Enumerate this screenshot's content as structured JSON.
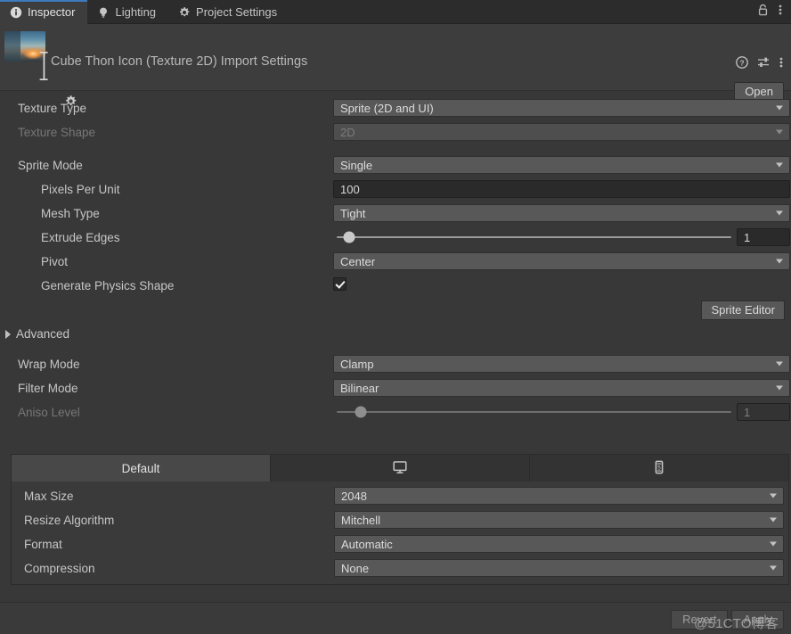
{
  "window": {
    "tabs": [
      {
        "label": "Inspector",
        "icon": "info-icon",
        "active": true
      },
      {
        "label": "Lighting",
        "icon": "lightbulb-icon",
        "active": false
      },
      {
        "label": "Project Settings",
        "icon": "gear-icon",
        "active": false
      }
    ],
    "lock_icon": "lock-icon",
    "menu_icon": "kebab-menu-icon"
  },
  "object_header": {
    "title": "Cube Thon Icon (Texture 2D) Import Settings",
    "thumbnail_alt": "texture-preview-thumbnail",
    "help_icon": "help-icon",
    "preset_icon": "preset-icon",
    "menu_icon": "kebab-menu-icon",
    "open_label": "Open",
    "gear_icon": "gear-icon"
  },
  "properties": [
    {
      "label": "Texture Type",
      "value": "Sprite (2D and UI)",
      "control": "dropdown",
      "disabled": false,
      "indent": 0
    },
    {
      "label": "Texture Shape",
      "value": "2D",
      "control": "dropdown",
      "disabled": true,
      "indent": 0
    }
  ],
  "sprite_section": [
    {
      "label": "Sprite Mode",
      "value": "Single",
      "control": "dropdown",
      "disabled": false,
      "indent": 0
    },
    {
      "label": "Pixels Per Unit",
      "value": "100",
      "control": "number",
      "disabled": false,
      "indent": 1
    },
    {
      "label": "Mesh Type",
      "value": "Tight",
      "control": "dropdown",
      "disabled": false,
      "indent": 1
    },
    {
      "label": "Extrude Edges",
      "value": "1",
      "control": "slider",
      "disabled": false,
      "indent": 1,
      "slider_pct": 4
    },
    {
      "label": "Pivot",
      "value": "Center",
      "control": "dropdown",
      "disabled": false,
      "indent": 1
    },
    {
      "label": "Generate Physics Shape",
      "value": "true",
      "control": "checkbox",
      "disabled": false,
      "indent": 1
    }
  ],
  "sprite_editor_label": "Sprite Editor",
  "advanced": {
    "label": "Advanced",
    "expanded": false,
    "arrow_icon": "chevron-right-icon"
  },
  "texture_section": [
    {
      "label": "Wrap Mode",
      "value": "Clamp",
      "control": "dropdown",
      "disabled": false,
      "indent": 0
    },
    {
      "label": "Filter Mode",
      "value": "Bilinear",
      "control": "dropdown",
      "disabled": false,
      "indent": 0
    },
    {
      "label": "Aniso Level",
      "value": "1",
      "control": "slider",
      "disabled": true,
      "indent": 0,
      "slider_pct": 7
    }
  ],
  "platform": {
    "tabs": [
      {
        "label": "Default",
        "icon": "",
        "active": true
      },
      {
        "label": "",
        "icon": "monitor-icon",
        "active": false
      },
      {
        "label": "",
        "icon": "mobile-device-icon",
        "active": false
      }
    ],
    "settings": [
      {
        "label": "Max Size",
        "value": "2048",
        "control": "dropdown",
        "disabled": false
      },
      {
        "label": "Resize Algorithm",
        "value": "Mitchell",
        "control": "dropdown",
        "disabled": false
      },
      {
        "label": "Format",
        "value": "Automatic",
        "control": "dropdown",
        "disabled": false
      },
      {
        "label": "Compression",
        "value": "None",
        "control": "dropdown",
        "disabled": false
      }
    ]
  },
  "footer": {
    "revert_label": "Revert",
    "apply_label": "Apply",
    "watermark": "@51CTO博客"
  },
  "colors": {
    "window_bg": "#383838",
    "header_bg": "#3D3D3D",
    "tabbar_bg": "#2C2C2C",
    "field_bg": "#585858",
    "number_bg": "#2A2A2A",
    "accent_blue": "#3E79BB",
    "text": "#C6C6C6",
    "text_dim": "#777777"
  }
}
